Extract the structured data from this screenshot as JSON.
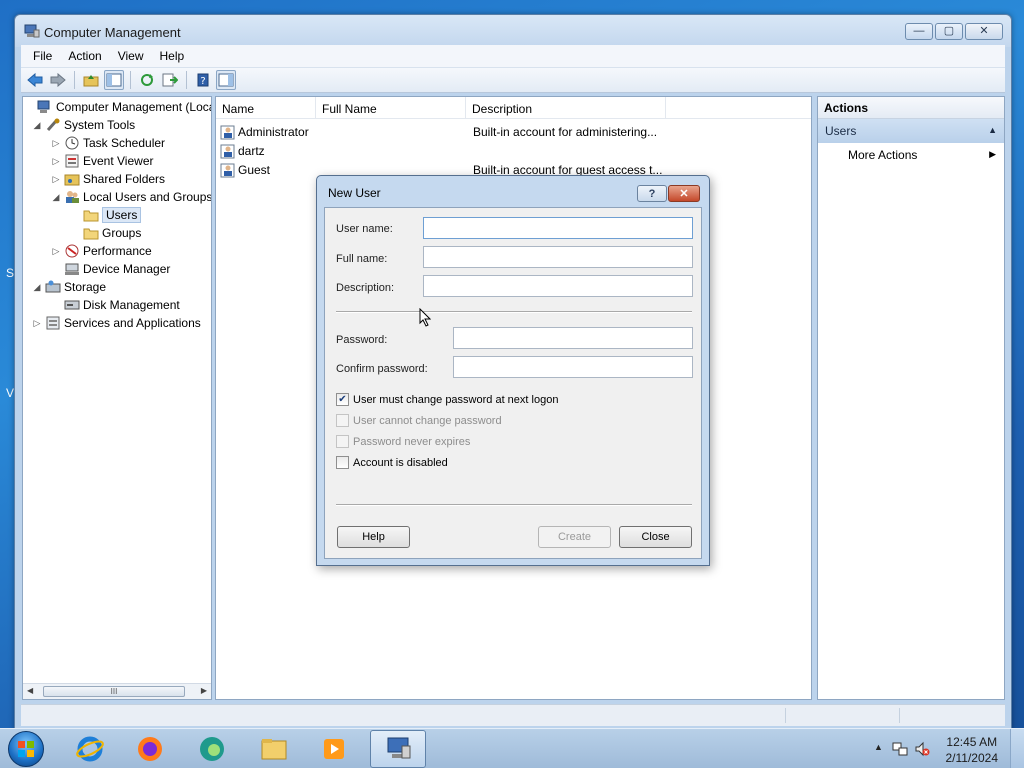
{
  "window": {
    "title": "Computer Management",
    "caption": {
      "min": "—",
      "max": "▢",
      "close": "✕"
    }
  },
  "menu": [
    "File",
    "Action",
    "View",
    "Help"
  ],
  "tree": {
    "root": "Computer Management (Local",
    "system_tools": "System Tools",
    "task_scheduler": "Task Scheduler",
    "event_viewer": "Event Viewer",
    "shared_folders": "Shared Folders",
    "local_users": "Local Users and Groups",
    "users": "Users",
    "groups": "Groups",
    "performance": "Performance",
    "device_manager": "Device Manager",
    "storage": "Storage",
    "disk_management": "Disk Management",
    "services": "Services and Applications",
    "scroll_thumb": "III"
  },
  "list": {
    "columns": [
      "Name",
      "Full Name",
      "Description"
    ],
    "rows": [
      {
        "name": "Administrator",
        "full_name": "",
        "description": "Built-in account for administering..."
      },
      {
        "name": "dartz",
        "full_name": "",
        "description": ""
      },
      {
        "name": "Guest",
        "full_name": "",
        "description": "Built-in account for guest access t..."
      }
    ]
  },
  "actions": {
    "title": "Actions",
    "section": "Users",
    "item": "More Actions"
  },
  "dialog": {
    "title": "New User",
    "help_glyph": "?",
    "close_glyph": "✕",
    "username_label": "User name:",
    "username_value": "",
    "fullname_label": "Full name:",
    "fullname_value": "",
    "description_label": "Description:",
    "description_value": "",
    "password_label": "Password:",
    "password_value": "",
    "confirm_label": "Confirm password:",
    "confirm_value": "",
    "checks": {
      "must_change": {
        "label": "User must change password at next logon",
        "checked": true,
        "enabled": true
      },
      "cannot_change": {
        "label": "User cannot change password",
        "checked": false,
        "enabled": false
      },
      "never_expires": {
        "label": "Password never expires",
        "checked": false,
        "enabled": false
      },
      "disabled": {
        "label": "Account is disabled",
        "checked": false,
        "enabled": true
      }
    },
    "help_button": "Help",
    "create_button": "Create",
    "close_button": "Close"
  },
  "taskbar": {
    "apps": [
      "internet-explorer",
      "firefox",
      "edge",
      "file-explorer",
      "media-player",
      "computer-management"
    ],
    "time": "12:45 AM",
    "date": "2/11/2024"
  },
  "desktop": {
    "frag1": "S",
    "frag2": "V"
  }
}
